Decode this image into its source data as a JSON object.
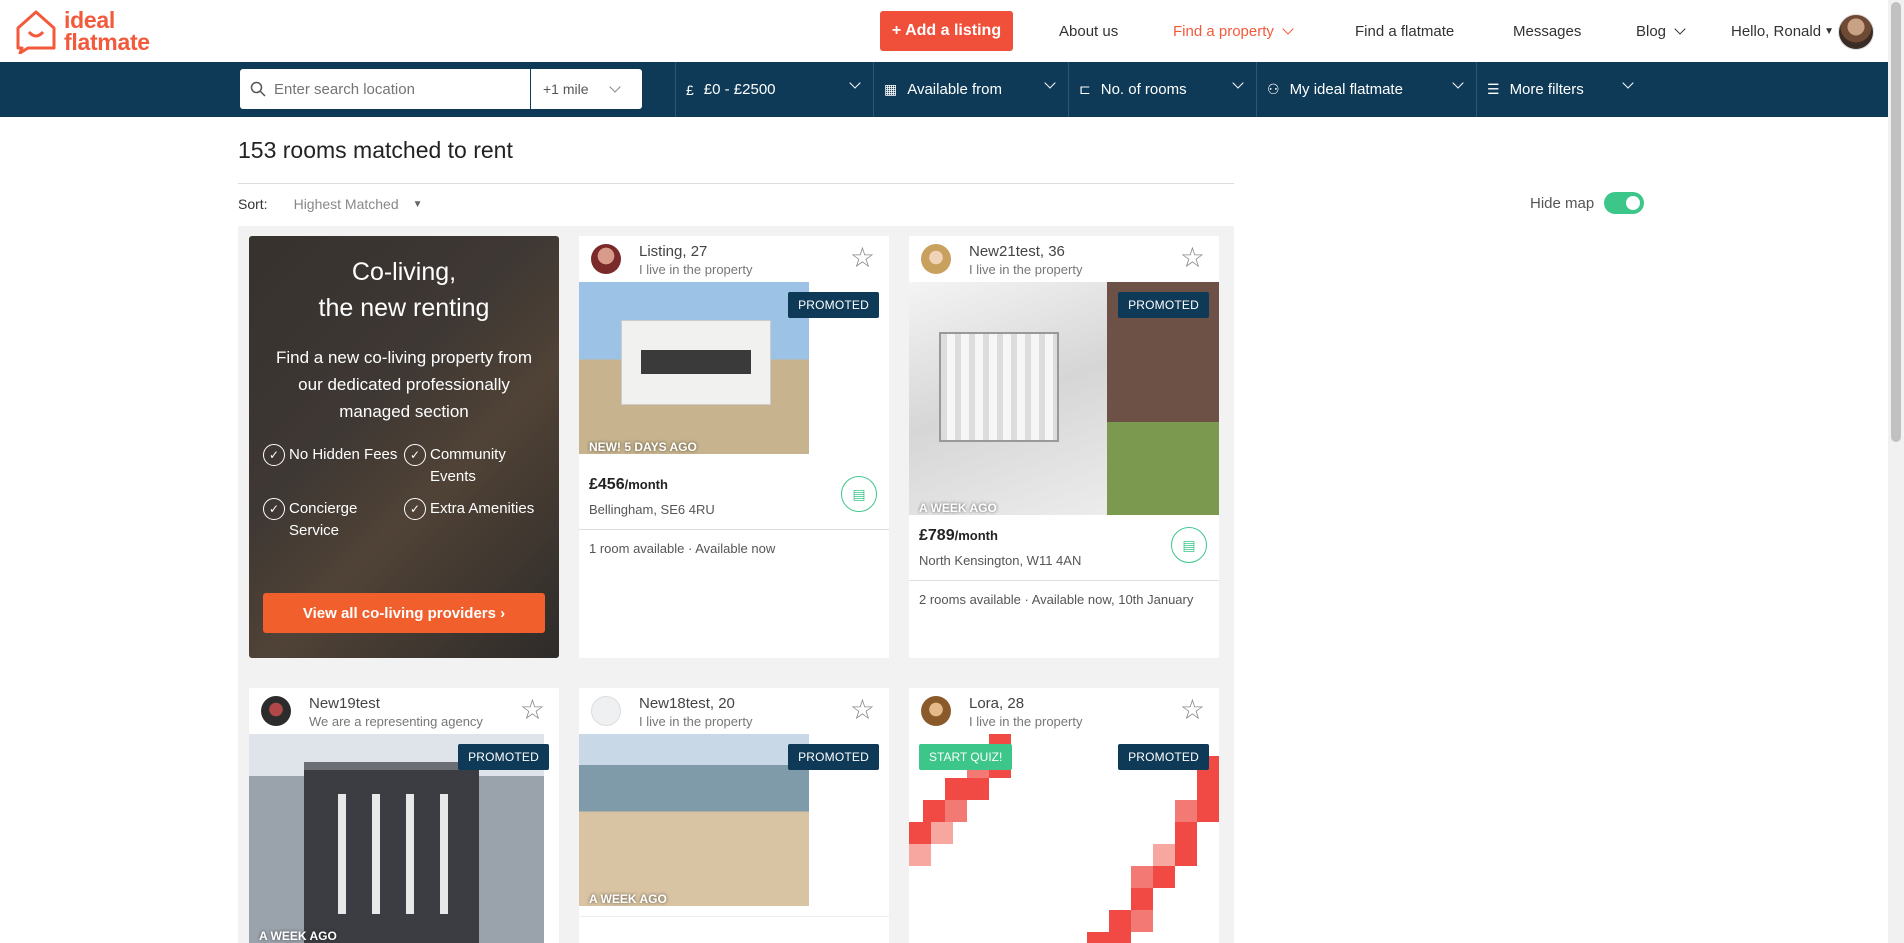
{
  "header": {
    "logo_line1": "ideal",
    "logo_line2": "flatmate",
    "add_listing": "+ Add a listing",
    "nav": {
      "about": "About us",
      "find_property": "Find a property",
      "find_flatmate": "Find a flatmate",
      "messages": "Messages",
      "blog": "Blog",
      "greeting": "Hello, Ronald"
    }
  },
  "filters": {
    "search_placeholder": "Enter search location",
    "radius": "+1 mile",
    "price": "£0 - £2500",
    "available": "Available from",
    "rooms": "No. of rooms",
    "flatmate": "My ideal flatmate",
    "more": "More filters"
  },
  "results": {
    "title": "153 rooms matched to rent",
    "sort_label": "Sort:",
    "sort_value": "Highest Matched",
    "hide_map": "Hide map"
  },
  "promo": {
    "title_line1": "Co-living,",
    "title_line2": "the new renting",
    "text": "Find a new co-living property from our dedicated professionally managed section",
    "features": [
      "No Hidden Fees",
      "Community Events",
      "Concierge Service",
      "Extra Amenities"
    ],
    "button": "View all co-living providers ›"
  },
  "listings": [
    {
      "name": "Listing, 27",
      "sub": "I live in the property",
      "badge": "PROMOTED",
      "ago": "NEW! 5 DAYS AGO",
      "price": "£456",
      "per": "/month",
      "address": "Bellingham, SE6 4RU",
      "availability": "1 room available · Available now"
    },
    {
      "name": "New21test, 36",
      "sub": "I live in the property",
      "badge": "PROMOTED",
      "ago": "A WEEK AGO",
      "price": "£789",
      "per": "/month",
      "address": "North Kensington, W11 4AN",
      "availability": "2 rooms available · Available now, 10th January"
    },
    {
      "name": "New19test",
      "sub": "We are a representing agency",
      "badge": "PROMOTED",
      "ago": "A WEEK AGO"
    },
    {
      "name": "New18test, 20",
      "sub": "I live in the property",
      "badge": "PROMOTED",
      "ago": "A WEEK AGO"
    },
    {
      "name": "Lora, 28",
      "sub": "I live in the property",
      "badge": "PROMOTED",
      "quiz": "START QUIZ!"
    }
  ],
  "colors": {
    "brand": "#f35a3b",
    "navy": "#0e3a57",
    "green": "#3cc68a",
    "orange": "#f15f2c"
  }
}
